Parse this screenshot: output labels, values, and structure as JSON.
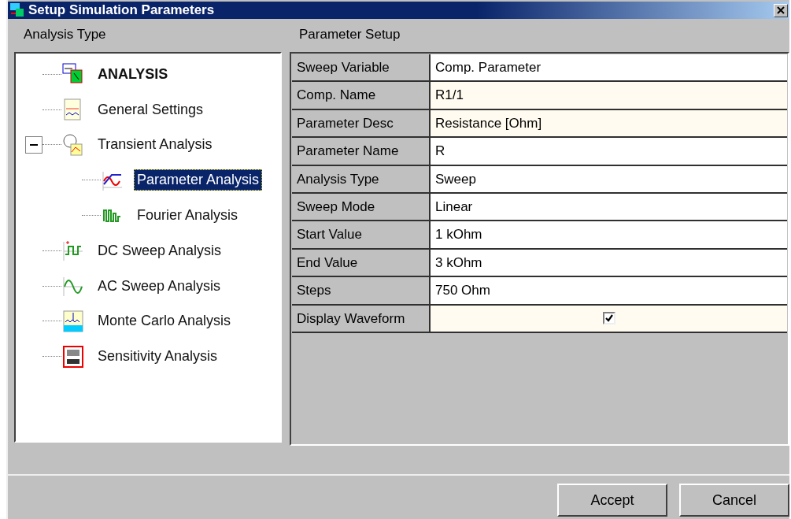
{
  "window": {
    "title": "Setup Simulation Parameters"
  },
  "left_panel": {
    "label": "Analysis Type"
  },
  "tree": [
    {
      "label": "ANALYSIS",
      "kind": "root",
      "selected": false,
      "children": [
        {
          "label": "General Settings",
          "kind": "settings",
          "selected": false
        },
        {
          "label": "Transient Analysis",
          "kind": "transient",
          "selected": false,
          "expanded": true,
          "children": [
            {
              "label": "Parameter Analysis",
              "kind": "parameter",
              "selected": true
            },
            {
              "label": "Fourier Analysis",
              "kind": "fourier",
              "selected": false
            }
          ]
        },
        {
          "label": "DC Sweep Analysis",
          "kind": "dc",
          "selected": false
        },
        {
          "label": "AC Sweep Analysis",
          "kind": "ac",
          "selected": false
        },
        {
          "label": "Monte Carlo Analysis",
          "kind": "montecarlo",
          "selected": false
        },
        {
          "label": "Sensitivity Analysis",
          "kind": "sensitivity",
          "selected": false
        }
      ]
    }
  ],
  "right_panel": {
    "label": "Parameter Setup"
  },
  "parameters": [
    {
      "name": "Sweep Variable",
      "kind": "text",
      "value": "Comp. Parameter",
      "readonly": false
    },
    {
      "name": "Comp. Name",
      "kind": "text",
      "value": "R1/1",
      "readonly": true
    },
    {
      "name": "Parameter Desc",
      "kind": "text",
      "value": "Resistance [Ohm]",
      "readonly": true
    },
    {
      "name": "Parameter Name",
      "kind": "text",
      "value": "R",
      "readonly": false
    },
    {
      "name": "Analysis Type",
      "kind": "text",
      "value": "Sweep",
      "readonly": false
    },
    {
      "name": "Sweep Mode",
      "kind": "text",
      "value": "Linear",
      "readonly": false
    },
    {
      "name": "Start Value",
      "kind": "text",
      "value": "1 kOhm",
      "readonly": false
    },
    {
      "name": "End Value",
      "kind": "text",
      "value": "3 kOhm",
      "readonly": false
    },
    {
      "name": "Steps",
      "kind": "text",
      "value": "750 Ohm",
      "readonly": false
    },
    {
      "name": "Display Waveform",
      "kind": "checkbox",
      "checked": true,
      "readonly": true
    }
  ],
  "buttons": [
    "Accept",
    "Cancel"
  ]
}
